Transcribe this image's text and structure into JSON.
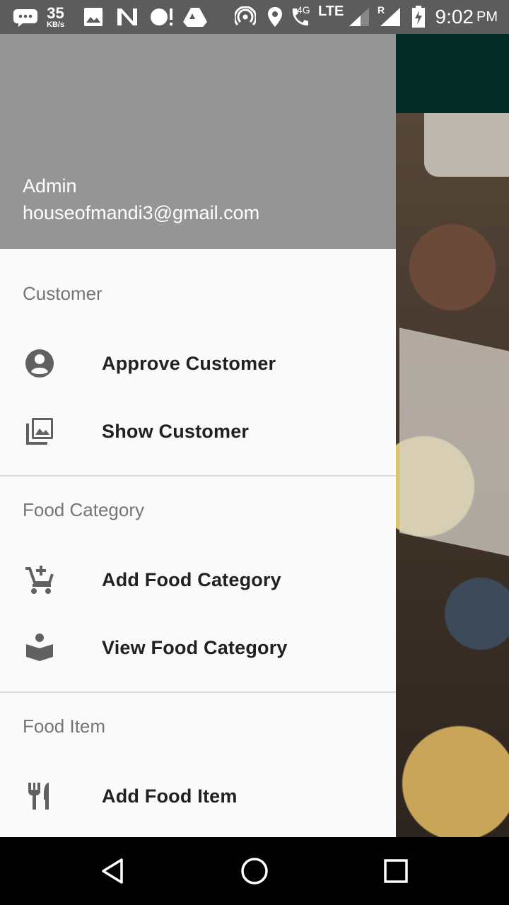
{
  "status_bar": {
    "speed_value": "35",
    "speed_unit": "KB/s",
    "network_4g": "4G",
    "network_lte": "LTE",
    "roaming": "R",
    "time": "9:02",
    "ampm": "PM",
    "icons": [
      "message-icon",
      "image-icon",
      "n-icon",
      "alert-icon",
      "drive-icon",
      "hotspot-icon",
      "location-icon",
      "call-icon",
      "signal-icon",
      "signal-icon",
      "battery-icon"
    ]
  },
  "drawer": {
    "header": {
      "name": "Admin",
      "email": "houseofmandi3@gmail.com",
      "background": "#959595"
    },
    "sections": [
      {
        "title": "Customer",
        "items": [
          {
            "label": "Approve Customer",
            "icon": "account-circle-icon"
          },
          {
            "label": "Show Customer",
            "icon": "photo-library-icon"
          }
        ]
      },
      {
        "title": "Food Category",
        "items": [
          {
            "label": "Add Food Category",
            "icon": "add-shopping-cart-icon"
          },
          {
            "label": "View Food Category",
            "icon": "book-reader-icon"
          }
        ]
      },
      {
        "title": "Food Item",
        "items": [
          {
            "label": "Add Food Item",
            "icon": "restaurant-icon"
          }
        ]
      }
    ]
  },
  "app": {
    "toolbar_color": "#032d24"
  },
  "colors": {
    "drawer_bg": "#fafafa",
    "section_title": "#757575",
    "item_text": "#212121",
    "icon": "#616161"
  }
}
